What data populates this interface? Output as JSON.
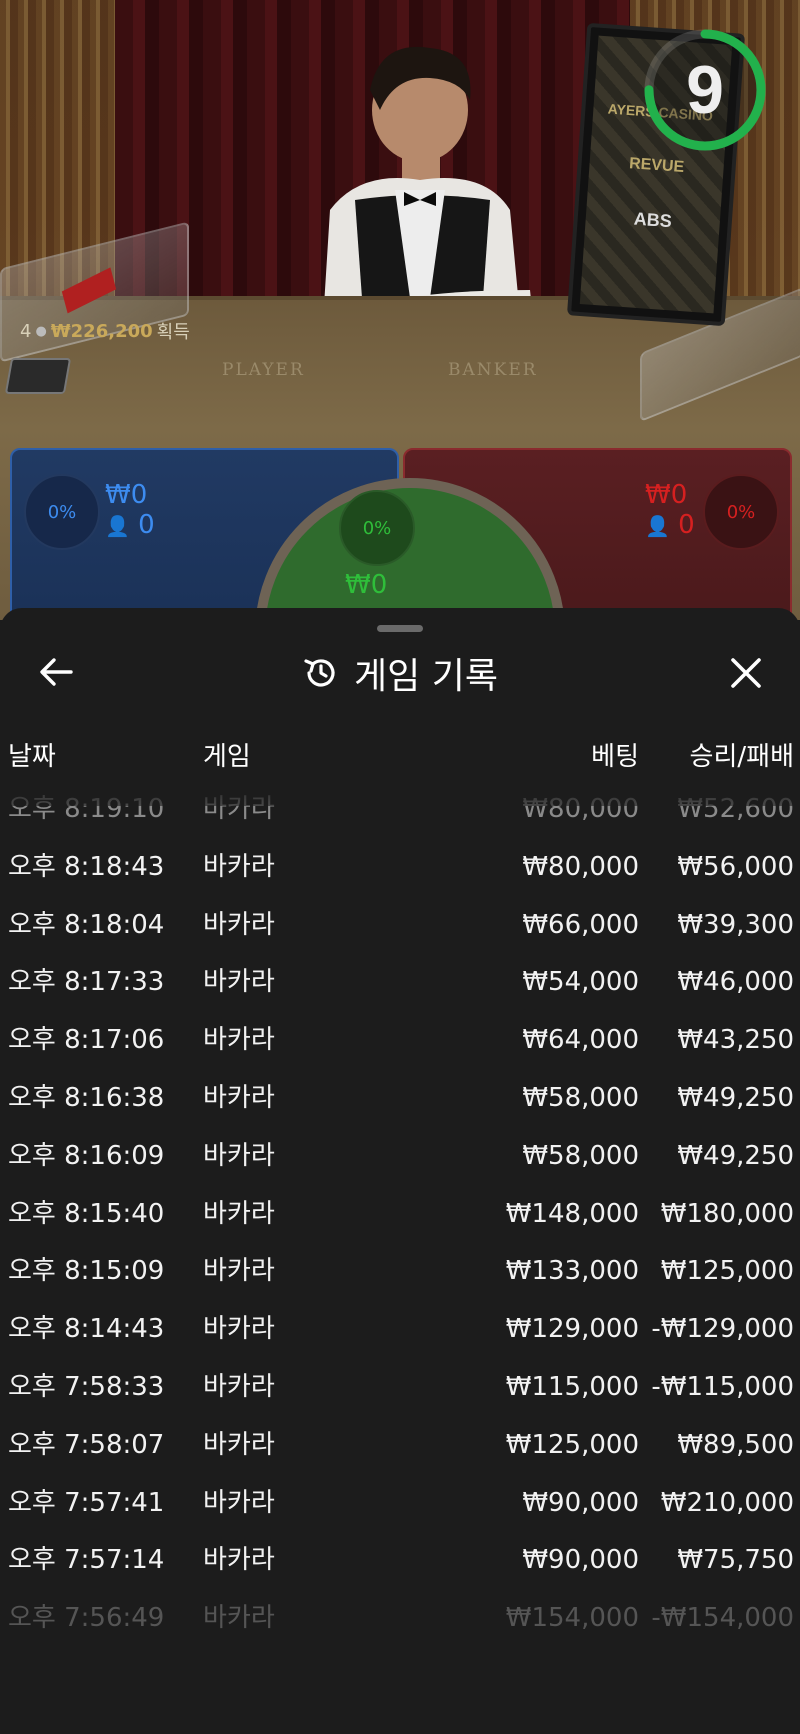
{
  "video": {
    "table_labels": {
      "player": "PLAYER",
      "banker": "BANKER"
    },
    "monitor_logos": [
      "AYERS CASINO",
      "REVUE",
      "ABS"
    ],
    "timer": {
      "seconds": "9",
      "progress": 0.75,
      "color": "#22b14c"
    },
    "balance": {
      "players": "4",
      "amount": "₩226,200",
      "suffix": "획득"
    }
  },
  "bets": {
    "player": {
      "percent": "0%",
      "amount": "₩0",
      "count": "0",
      "color": "#2f7fe0"
    },
    "banker": {
      "percent": "0%",
      "amount": "₩0",
      "count": "0",
      "color": "#d62020"
    },
    "tie": {
      "percent": "0%",
      "amount": "₩0",
      "color": "#2fbe3a"
    }
  },
  "sheet": {
    "title": "게임 기록",
    "back_icon": "arrow-left-icon",
    "history_icon": "history-icon",
    "close_icon": "close-icon",
    "columns": {
      "date": "날짜",
      "game": "게임",
      "bet": "베팅",
      "win_loss": "승리/패배"
    },
    "rows": [
      {
        "date": "오후 8:19:10",
        "game": "바카라",
        "bet": "₩80,000",
        "result": "₩52,600"
      },
      {
        "date": "오후 8:18:43",
        "game": "바카라",
        "bet": "₩80,000",
        "result": "₩56,000"
      },
      {
        "date": "오후 8:18:04",
        "game": "바카라",
        "bet": "₩66,000",
        "result": "₩39,300"
      },
      {
        "date": "오후 8:17:33",
        "game": "바카라",
        "bet": "₩54,000",
        "result": "₩46,000"
      },
      {
        "date": "오후 8:17:06",
        "game": "바카라",
        "bet": "₩64,000",
        "result": "₩43,250"
      },
      {
        "date": "오후 8:16:38",
        "game": "바카라",
        "bet": "₩58,000",
        "result": "₩49,250"
      },
      {
        "date": "오후 8:16:09",
        "game": "바카라",
        "bet": "₩58,000",
        "result": "₩49,250"
      },
      {
        "date": "오후 8:15:40",
        "game": "바카라",
        "bet": "₩148,000",
        "result": "₩180,000"
      },
      {
        "date": "오후 8:15:09",
        "game": "바카라",
        "bet": "₩133,000",
        "result": "₩125,000"
      },
      {
        "date": "오후 8:14:43",
        "game": "바카라",
        "bet": "₩129,000",
        "result": "-₩129,000"
      },
      {
        "date": "오후 7:58:33",
        "game": "바카라",
        "bet": "₩115,000",
        "result": "-₩115,000"
      },
      {
        "date": "오후 7:58:07",
        "game": "바카라",
        "bet": "₩125,000",
        "result": "₩89,500"
      },
      {
        "date": "오후 7:57:41",
        "game": "바카라",
        "bet": "₩90,000",
        "result": "₩210,000"
      },
      {
        "date": "오후 7:57:14",
        "game": "바카라",
        "bet": "₩90,000",
        "result": "₩75,750"
      },
      {
        "date": "오후 7:56:49",
        "game": "바카라",
        "bet": "₩154,000",
        "result": "-₩154,000"
      }
    ]
  }
}
